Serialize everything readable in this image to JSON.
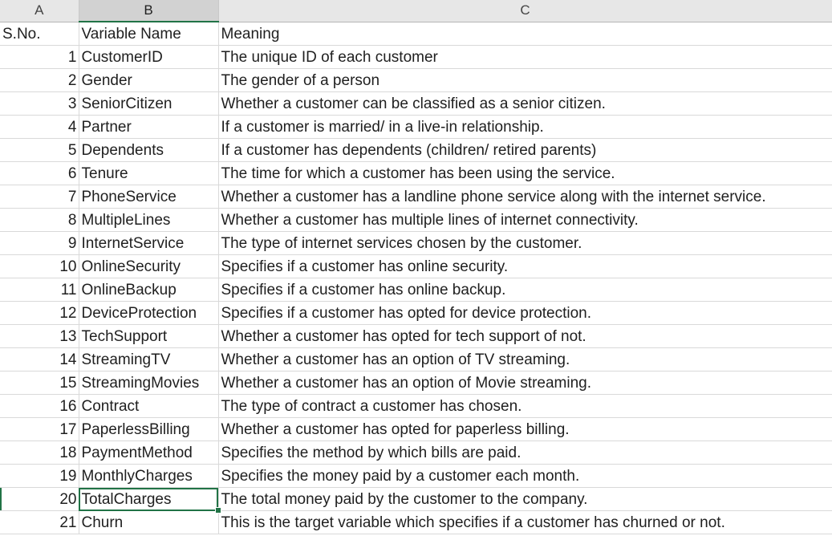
{
  "columns": [
    "A",
    "B",
    "C"
  ],
  "header": {
    "sno": "S.No.",
    "variable": "Variable Name",
    "meaning": "Meaning"
  },
  "rows": [
    {
      "sno": "1",
      "variable": "CustomerID",
      "meaning": "The unique ID of each customer"
    },
    {
      "sno": "2",
      "variable": "Gender",
      "meaning": "The gender of a person"
    },
    {
      "sno": "3",
      "variable": "SeniorCitizen",
      "meaning": "Whether a customer can be classified as a senior citizen."
    },
    {
      "sno": "4",
      "variable": "Partner",
      "meaning": "If a customer is married/ in a live-in relationship."
    },
    {
      "sno": "5",
      "variable": "Dependents",
      "meaning": "If a customer has dependents (children/ retired parents)"
    },
    {
      "sno": "6",
      "variable": "Tenure",
      "meaning": "The time for which a customer has been using the service."
    },
    {
      "sno": "7",
      "variable": "PhoneService",
      "meaning": "Whether a customer has a landline phone service along with the internet service."
    },
    {
      "sno": "8",
      "variable": "MultipleLines",
      "meaning": "Whether a customer has multiple lines of internet connectivity."
    },
    {
      "sno": "9",
      "variable": "InternetService",
      "meaning": "The type of internet services chosen by the customer."
    },
    {
      "sno": "10",
      "variable": "OnlineSecurity",
      "meaning": "Specifies if a customer has online security."
    },
    {
      "sno": "11",
      "variable": "OnlineBackup",
      "meaning": "Specifies if a customer has online backup."
    },
    {
      "sno": "12",
      "variable": "DeviceProtection",
      "meaning": "Specifies if a customer has opted for device protection."
    },
    {
      "sno": "13",
      "variable": "TechSupport",
      "meaning": "Whether a customer has opted for tech support of not."
    },
    {
      "sno": "14",
      "variable": "StreamingTV",
      "meaning": "Whether a customer has an option of TV streaming."
    },
    {
      "sno": "15",
      "variable": "StreamingMovies",
      "meaning": "Whether a customer has an option of Movie streaming."
    },
    {
      "sno": "16",
      "variable": "Contract",
      "meaning": "The type of contract a customer has chosen."
    },
    {
      "sno": "17",
      "variable": "PaperlessBilling",
      "meaning": "Whether a customer has opted for paperless billing."
    },
    {
      "sno": "18",
      "variable": "PaymentMethod",
      "meaning": "Specifies the method by which bills are paid."
    },
    {
      "sno": "19",
      "variable": "MonthlyCharges",
      "meaning": "Specifies the money paid by a customer each month."
    },
    {
      "sno": "20",
      "variable": "TotalCharges",
      "meaning": "The total money paid by the customer to the company."
    },
    {
      "sno": "21",
      "variable": "Churn",
      "meaning": "This is the target variable which specifies if a customer has churned or not."
    }
  ],
  "active_row_index": 19,
  "selected_column": "B",
  "colors": {
    "accent": "#217346",
    "header_bg": "#e7e7e7",
    "grid": "#d9d9d9"
  }
}
